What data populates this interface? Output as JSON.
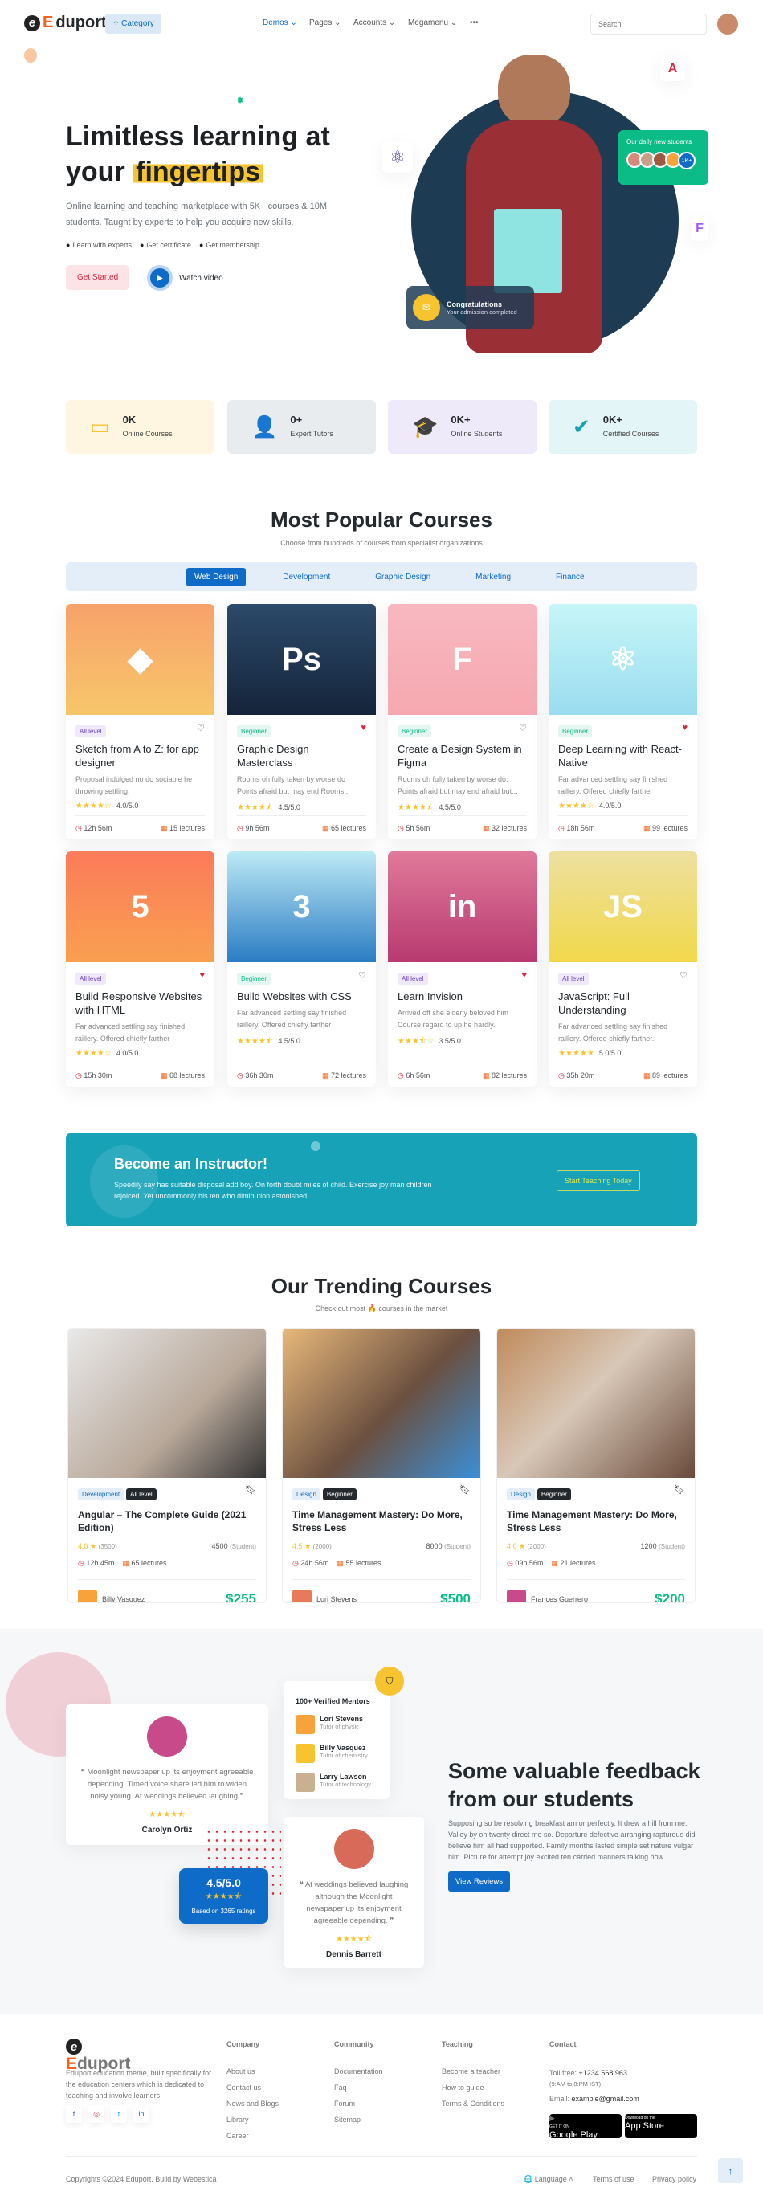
{
  "colors": {
    "primary": "#0e6bc7",
    "orange": "#f7631b",
    "yellow": "#f7c32e",
    "teal": "#17a2b8",
    "green": "#0cbc87",
    "danger": "#d6293e"
  },
  "nav": {
    "brand": "Eduport",
    "category": "Category",
    "links": [
      "Demos",
      "Pages",
      "Accounts",
      "Megamenu"
    ],
    "more": "•••",
    "search_placeholder": "Search"
  },
  "hero": {
    "title_line1": "Limitless learning at",
    "title_plain": "your",
    "title_highlight": "fingertips",
    "desc": "Online learning and teaching marketplace with 5K+ courses & 10M students. Taught by experts to help you acquire new skills.",
    "checks": [
      "Learn with experts",
      "Get certificate",
      "Get membership"
    ],
    "cta": "Get Started",
    "video": "Watch video",
    "daily_title": "Our daily new students",
    "daily_count": "1K+",
    "congrats_title": "Congratulations",
    "congrats_sub": "Your admission completed"
  },
  "stats": [
    {
      "value": "0K",
      "label": "Online Courses",
      "icon": "monitor-icon",
      "bg": "#fef6e0",
      "color": "#f7c32e"
    },
    {
      "value": "0+",
      "label": "Expert Tutors",
      "icon": "tutor-icon",
      "bg": "#e9ecef",
      "color": "#1d3b53"
    },
    {
      "value": "0K+",
      "label": "Online Students",
      "icon": "graduate-icon",
      "bg": "#efeaf9",
      "color": "#6f42c1"
    },
    {
      "value": "0K+",
      "label": "Certified Courses",
      "icon": "badge-check-icon",
      "bg": "#e4f5f7",
      "color": "#17a2b8"
    }
  ],
  "popular": {
    "title": "Most Popular Courses",
    "subtitle": "Choose from hundreds of courses from specialist organizations",
    "tabs": [
      "Web Design",
      "Development",
      "Graphic Design",
      "Marketing",
      "Finance"
    ],
    "active_tab": "Web Design",
    "courses": [
      {
        "level": "All level",
        "title": "Sketch from A to Z: for app designer",
        "desc": "Proposal indulged no do sociable he throwing settling.",
        "rating": 4.0,
        "rating_text": "4.0/5.0",
        "duration": "12h 56m",
        "lectures": "15 lectures",
        "liked": false,
        "icon": "sketch-icon",
        "glyph": "◆",
        "bg": "linear-gradient(#f7a26a,#f7c66a)"
      },
      {
        "level": "Beginner",
        "title": "Graphic Design Masterclass",
        "desc": "Rooms oh fully taken by worse do Points afraid but may end Rooms...",
        "rating": 4.5,
        "rating_text": "4.5/5.0",
        "duration": "9h 56m",
        "lectures": "65 lectures",
        "liked": true,
        "icon": "photoshop-icon",
        "glyph": "Ps",
        "bg": "linear-gradient(#2c4a6a,#14243a)"
      },
      {
        "level": "Beginner",
        "title": "Create a Design System in Figma",
        "desc": "Rooms oh fully taken by worse do. Points afraid but may end afraid but...",
        "rating": 4.5,
        "rating_text": "4.5/5.0",
        "duration": "5h 56m",
        "lectures": "32 lectures",
        "liked": false,
        "icon": "figma-icon",
        "glyph": "F",
        "bg": "linear-gradient(#f8b8c0,#f6a8b0)"
      },
      {
        "level": "Beginner",
        "title": "Deep Learning with React-Native",
        "desc": "Far advanced settling say finished raillery. Offered chiefly farther",
        "rating": 4.0,
        "rating_text": "4.0/5.0",
        "duration": "18h 56m",
        "lectures": "99 lectures",
        "liked": true,
        "icon": "react-icon",
        "glyph": "⚛",
        "bg": "linear-gradient(#c6f6f8,#9adcf0)"
      },
      {
        "level": "All level",
        "title": "Build Responsive Websites with HTML",
        "desc": "Far advanced settling say finished raillery. Offered chiefly farther",
        "rating": 4.0,
        "rating_text": "4.0/5.0",
        "duration": "15h 30m",
        "lectures": "68 lectures",
        "liked": true,
        "icon": "html5-icon",
        "glyph": "5",
        "bg": "linear-gradient(#fb7b5a,#f9a050)"
      },
      {
        "level": "Beginner",
        "title": "Build Websites with CSS",
        "desc": "Far advanced settling say finished raillery. Offered chiefly farther",
        "rating": 4.5,
        "rating_text": "4.5/5.0",
        "duration": "36h 30m",
        "lectures": "72 lectures",
        "liked": false,
        "icon": "css3-icon",
        "glyph": "3",
        "bg": "linear-gradient(#bdeaf5,#2a7cc4)"
      },
      {
        "level": "All level",
        "title": "Learn Invision",
        "desc": "Arrived off she elderly beloved him Course regard to up he hardly.",
        "rating": 3.5,
        "rating_text": "3.5/5.0",
        "duration": "6h 56m",
        "lectures": "82 lectures",
        "liked": true,
        "icon": "invision-icon",
        "glyph": "in",
        "bg": "linear-gradient(#e07a9a,#b83a70)"
      },
      {
        "level": "All level",
        "title": "JavaScript: Full Understanding",
        "desc": "Far advanced settling say finished raillery. Offered chiefly farther.",
        "rating": 5.0,
        "rating_text": "5.0/5.0",
        "duration": "35h 20m",
        "lectures": "89 lectures",
        "liked": false,
        "icon": "javascript-icon",
        "glyph": "JS",
        "bg": "linear-gradient(#ede0a0,#f1d84a)"
      }
    ]
  },
  "instructor": {
    "title": "Become an Instructor!",
    "desc": "Speedily say has suitable disposal add boy. On forth doubt miles of child. Exercise joy man children rejoiced. Yet uncommonly his ten who diminution astonished.",
    "button": "Start Teaching Today"
  },
  "trending": {
    "title": "Our Trending Courses",
    "subtitle_pre": "Check out most",
    "subtitle_post": "courses in the market",
    "student_label": "(Student)",
    "courses": [
      {
        "category": "Development",
        "level": "All level",
        "title": "Angular – The Complete Guide (2021 Edition)",
        "rating": "4.0",
        "reviews": "(3500)",
        "students": "4500",
        "duration": "12h 45m",
        "lectures": "65 lectures",
        "instructor": "Billy Vasquez",
        "price": "$255",
        "bg": "linear-gradient(135deg,#e9e9e9,#b8a89a 60%,#333)"
      },
      {
        "category": "Design",
        "level": "Beginner",
        "title": "Time Management Mastery: Do More, Stress Less",
        "rating": "4.5",
        "reviews": "(2000)",
        "students": "8000",
        "duration": "24h 56m",
        "lectures": "55 lectures",
        "instructor": "Lori Stevens",
        "price": "$500",
        "bg": "linear-gradient(135deg,#e8b87a,#6b5040 55%,#3a8fd8)"
      },
      {
        "category": "Design",
        "level": "Beginner",
        "title": "Time Management Mastery: Do More, Stress Less",
        "rating": "4.0",
        "reviews": "(2000)",
        "students": "1200",
        "duration": "09h 56m",
        "lectures": "21 lectures",
        "instructor": "Frances Guerrero",
        "price": "$200",
        "bg": "linear-gradient(135deg,#c08a5a,#d8c8b8 45%,#6a4a3a)"
      }
    ]
  },
  "feedback": {
    "title_line1": "Some valuable feedback",
    "title_line2": "from our students",
    "desc": "Supposing so be resolving breakfast am or perfectly. It drew a hill from me. Valley by oh twenty direct me so. Departure defective arranging rapturous did believe him all had supported. Family months lasted simple set nature vulgar him. Picture for attempt joy excited ten carried manners talking how.",
    "button": "View Reviews",
    "review1": {
      "text": "Moonlight newspaper up its enjoyment agreeable depending. Timed voice share led him to widen noisy young. At weddings believed laughing",
      "name": "Carolyn Ortiz",
      "stars": 4.5
    },
    "review2": {
      "text": "At weddings believed laughing although the Moonlight newspaper up its enjoyment agreeable depending.",
      "name": "Dennis Barrett",
      "stars": 4.5
    },
    "mentors_title": "100+ Verified Mentors",
    "mentors": [
      {
        "name": "Lori Stevens",
        "role": "Tutor of physic"
      },
      {
        "name": "Billy Vasquez",
        "role": "Tutor of chemistry"
      },
      {
        "name": "Larry Lawson",
        "role": "Tutor of technology"
      }
    ],
    "rating": "4.5/5.0",
    "rating_stars": 4.5,
    "rating_note": "Based on 3265 ratings"
  },
  "footer": {
    "brand": "Eduport",
    "about": "Eduport education theme, built specifically for the education centers which is dedicated to teaching and involve learners.",
    "columns": [
      {
        "title": "Company",
        "links": [
          "About us",
          "Contact us",
          "News and Blogs",
          "Library",
          "Career"
        ]
      },
      {
        "title": "Community",
        "links": [
          "Documentation",
          "Faq",
          "Forum",
          "Sitemap"
        ]
      },
      {
        "title": "Teaching",
        "links": [
          "Become a teacher",
          "How to guide",
          "Terms & Conditions"
        ]
      }
    ],
    "contact_title": "Contact",
    "toll_label": "Toll free:",
    "toll": "+1234 568 963",
    "hours": "(9:AM to 8:PM IST)",
    "email_label": "Email:",
    "email": "example@gmail.com",
    "google_small": "GET IT ON",
    "google": "Google Play",
    "apple_small": "Download on the",
    "apple": "App Store",
    "copyright": "Copyrights ©2024 Eduport. Build by Webestica",
    "language": "Language",
    "terms": "Terms of use",
    "privacy": "Privacy policy"
  }
}
